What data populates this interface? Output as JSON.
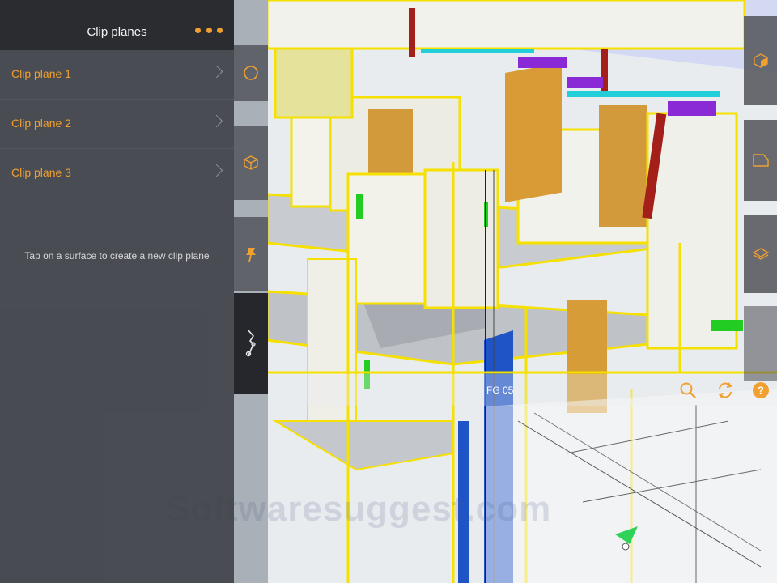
{
  "panel": {
    "title": "Clip planes",
    "items": [
      {
        "label": "Clip plane 1"
      },
      {
        "label": "Clip plane 2"
      },
      {
        "label": "Clip plane 3"
      }
    ],
    "hint": "Tap on a surface to create a new clip plane"
  },
  "plan_overlay": {
    "sheet_name": "FG 05"
  },
  "watermark": "Softwaresuggest.com",
  "colors": {
    "accent": "#f0a030",
    "panel_bg": "#3c3f46",
    "header_bg": "#2a2c30",
    "model_outline": "#f5e000"
  },
  "icons": {
    "left_toolbar": [
      "circle-icon",
      "cube-icon",
      "pin-icon",
      "clip-tool-icon"
    ],
    "right_toolbar": [
      "cube-orient-icon",
      "sheet-icon",
      "layers-icon"
    ],
    "plan_bar": [
      "search-icon",
      "sync-icon",
      "help-icon"
    ]
  }
}
